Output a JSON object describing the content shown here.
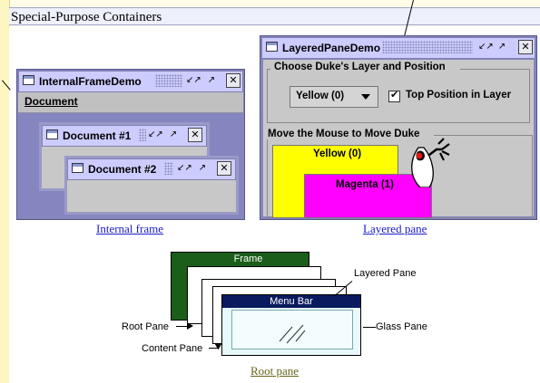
{
  "page": {
    "header_title": "Special-Purpose Containers"
  },
  "internal_frame_demo": {
    "title": "InternalFrameDemo",
    "menu_item": "Document",
    "doc1_title": "Document #1",
    "doc2_title": "Document #2",
    "caption": "Internal frame"
  },
  "layered_pane_demo": {
    "title": "LayeredPaneDemo",
    "group1_label": "Choose Duke's Layer and Position",
    "combo_value": "Yellow (0)",
    "checkbox_label": "Top Position in Layer",
    "checkbox_checked": true,
    "group2_label": "Move the Mouse to Move Duke",
    "yellow_label": "Yellow (0)",
    "magenta_label": "Magenta (1)",
    "caption": "Layered pane"
  },
  "root_pane_diagram": {
    "frame_label": "Frame",
    "menu_bar_label": "Menu Bar",
    "layered_pane_label": "Layered Pane",
    "root_pane_label": "Root Pane",
    "content_pane_label": "Content Pane",
    "glass_pane_label": "Glass Pane",
    "caption": "Root pane"
  },
  "colors": {
    "title_bar": "#ccccff",
    "desktop": "#8585c0",
    "yellow_panel": "#ffff00",
    "magenta_panel": "#ff00ff",
    "frame_green": "#1a5e1a",
    "menu_bar_navy": "#0a1a5e",
    "glass_cyan": "#e8f8fb"
  },
  "icons": [
    "window-icon",
    "minimize-icon",
    "maximize-icon",
    "close-icon",
    "checkmark-icon",
    "combo-arrow-icon",
    "duke-icon"
  ]
}
